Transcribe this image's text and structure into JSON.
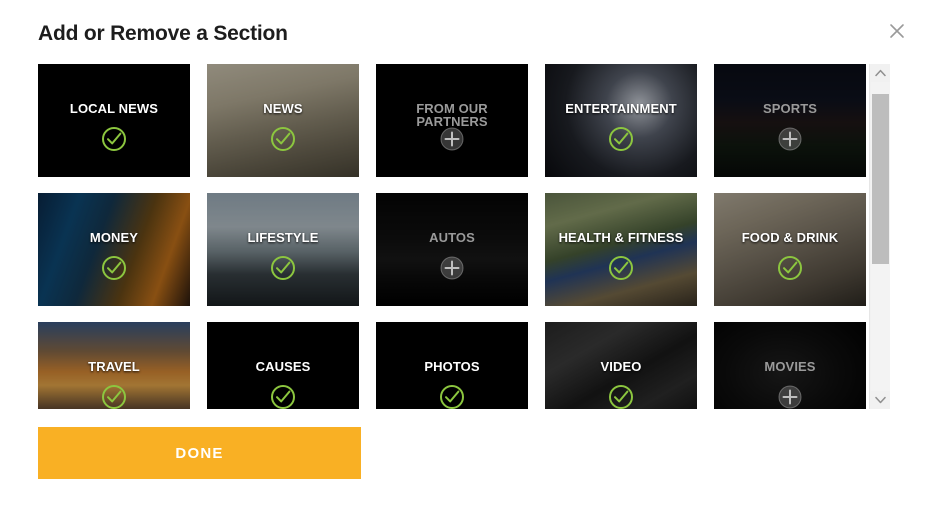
{
  "dialog": {
    "title": "Add or Remove a Section",
    "close_icon": "close-icon",
    "close_label": "Close"
  },
  "colors": {
    "accent_button": "#f9b024",
    "selected_check": "#8cc63f",
    "unselected_plus": "#4a4a4a",
    "tile_background": "#000000",
    "scrollbar_thumb": "#bdbdbd",
    "scrollbar_track": "#f1f1f1",
    "title_text": "#1d1d1d"
  },
  "sections": [
    {
      "label": "LOCAL NEWS",
      "selected": true,
      "state_icon": "check-circle-icon",
      "image": "bg-plain"
    },
    {
      "label": "NEWS",
      "selected": true,
      "state_icon": "check-circle-icon",
      "image": "bg-news"
    },
    {
      "label": "FROM OUR PARTNERS",
      "selected": false,
      "state_icon": "plus-circle-icon",
      "image": "bg-plain"
    },
    {
      "label": "ENTERTAINMENT",
      "selected": true,
      "state_icon": "check-circle-icon",
      "image": "bg-enter"
    },
    {
      "label": "SPORTS",
      "selected": false,
      "state_icon": "plus-circle-icon",
      "image": "bg-sports"
    },
    {
      "label": "MONEY",
      "selected": true,
      "state_icon": "check-circle-icon",
      "image": "bg-money"
    },
    {
      "label": "LIFESTYLE",
      "selected": true,
      "state_icon": "check-circle-icon",
      "image": "bg-lifestyle"
    },
    {
      "label": "AUTOS",
      "selected": false,
      "state_icon": "plus-circle-icon",
      "image": "bg-autos"
    },
    {
      "label": "HEALTH & FITNESS",
      "selected": true,
      "state_icon": "check-circle-icon",
      "image": "bg-health"
    },
    {
      "label": "FOOD & DRINK",
      "selected": true,
      "state_icon": "check-circle-icon",
      "image": "bg-food"
    },
    {
      "label": "TRAVEL",
      "selected": true,
      "state_icon": "check-circle-icon",
      "image": "bg-travel"
    },
    {
      "label": "CAUSES",
      "selected": true,
      "state_icon": "check-circle-icon",
      "image": "bg-plain"
    },
    {
      "label": "PHOTOS",
      "selected": true,
      "state_icon": "check-circle-icon",
      "image": "bg-plain"
    },
    {
      "label": "VIDEO",
      "selected": true,
      "state_icon": "check-circle-icon",
      "image": "bg-video"
    },
    {
      "label": "MOVIES",
      "selected": false,
      "state_icon": "plus-circle-icon",
      "image": "bg-movies"
    }
  ],
  "scrollbar": {
    "up_icon": "chevron-up-icon",
    "down_icon": "chevron-down-icon",
    "thumb_top_pct": 4,
    "thumb_height_pct": 55
  },
  "footer": {
    "done_label": "DONE"
  }
}
